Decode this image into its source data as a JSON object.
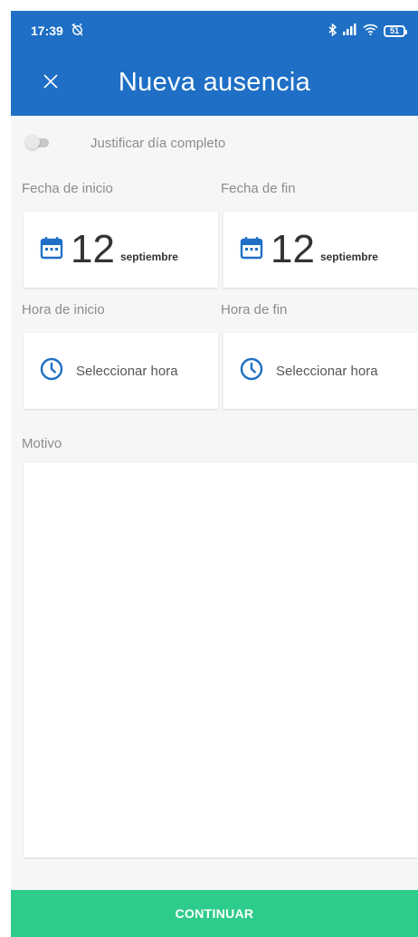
{
  "status_bar": {
    "time": "17:39",
    "battery": "51"
  },
  "app_bar": {
    "title": "Nueva ausencia",
    "close_icon": "close-icon"
  },
  "full_day_toggle": {
    "label": "Justificar día completo",
    "checked": false
  },
  "start_date": {
    "label": "Fecha de inicio",
    "day": "12",
    "month": "septiembre"
  },
  "end_date": {
    "label": "Fecha de fin",
    "day": "12",
    "month": "septiembre"
  },
  "start_time": {
    "label": "Hora de inicio",
    "placeholder": "Seleccionar hora"
  },
  "end_time": {
    "label": "Hora de fin",
    "placeholder": "Seleccionar hora"
  },
  "reason": {
    "label": "Motivo",
    "value": ""
  },
  "submit": {
    "label": "CONTINUAR"
  },
  "colors": {
    "primary": "#1e6fc5",
    "accent_green": "#2ecc8a",
    "icon_blue": "#1e6fc5"
  }
}
